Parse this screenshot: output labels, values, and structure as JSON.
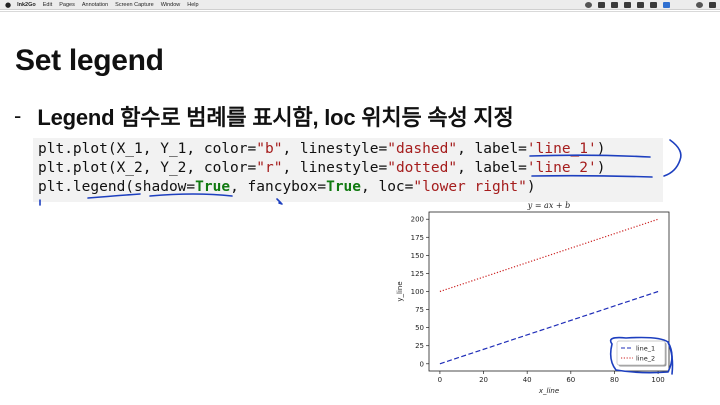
{
  "menubar": {
    "app_name": "Ink2Go",
    "items": [
      "Edit",
      "Pages",
      "Annotation",
      "Screen Capture",
      "Window",
      "Help"
    ]
  },
  "slide": {
    "title": "Set legend",
    "bullet_dash": "-",
    "bullet_text": "Legend 함수로 범례를 표시함, loc 위치등 속성 지정",
    "code": {
      "line1": {
        "p1": "plt.plot(X_1, Y_1, color=",
        "s1": "\"b\"",
        "p2": ", linestyle=",
        "s2": "\"dashed\"",
        "p3": ", label=",
        "s3": "'line_1'",
        "p4": ")"
      },
      "line2": {
        "p1": "plt.plot(X_2, Y_2, color=",
        "s1": "\"r\"",
        "p2": ", linestyle=",
        "s2": "\"dotted\"",
        "p3": ", label=",
        "s3": "'line_2'",
        "p4": ")"
      },
      "line3": {
        "p1": "plt.legend(shadow=",
        "k1": "True",
        "p2": ", fancybox=",
        "k2": "True",
        "p3": ", loc=",
        "s1": "\"lower right\"",
        "p4": ")"
      }
    }
  },
  "colors": {
    "string": "#a51d1d",
    "keyword": "#117a11",
    "annotation": "#1d3fbf",
    "line_1": "#1f2db8",
    "line_2": "#cc2222"
  },
  "chart_data": {
    "type": "line",
    "title": "y = ax + b",
    "xlabel": "x_line",
    "ylabel": "y_line",
    "xlim": [
      -5,
      105
    ],
    "ylim": [
      -10,
      210
    ],
    "xticks": [
      0,
      20,
      40,
      60,
      80,
      100
    ],
    "yticks": [
      0,
      25,
      50,
      75,
      100,
      125,
      150,
      175,
      200
    ],
    "grid": false,
    "legend_position": "lower right",
    "series": [
      {
        "name": "line_1",
        "style": "dashed",
        "color": "#1f2db8",
        "x": [
          0,
          100
        ],
        "y": [
          0,
          100
        ]
      },
      {
        "name": "line_2",
        "style": "dotted",
        "color": "#cc2222",
        "x": [
          0,
          100
        ],
        "y": [
          100,
          200
        ]
      }
    ]
  }
}
